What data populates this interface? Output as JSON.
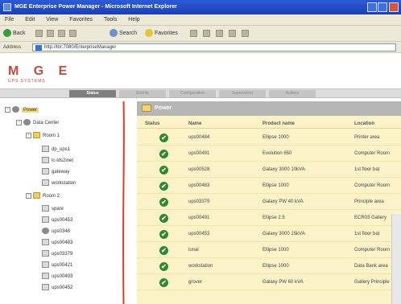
{
  "window": {
    "title": "MGE Enterprise Power Manager - Microsoft Internet Explorer"
  },
  "menu": [
    "File",
    "Edit",
    "View",
    "Favorites",
    "Tools",
    "Help"
  ],
  "toolbar": {
    "back_label": "Back",
    "search_label": "Search",
    "favorites_label": "Favorites"
  },
  "address": {
    "label": "Address",
    "value": "http://lbr:7080/EnterpriseManager"
  },
  "brand": {
    "logo": "M G E",
    "tagline": "UPS SYSTEMS"
  },
  "tabs": [
    "Status",
    "Events",
    "Configuration",
    "Supervision",
    "Actions"
  ],
  "tree": {
    "root": "Power",
    "datacenter": "Data Center",
    "rooms": [
      "Room 1",
      "Room 2"
    ],
    "room1_items": [
      "dp_ups1",
      "lc-lds2inet",
      "gateway",
      "workstation"
    ],
    "room2_items": [
      "spare",
      "ups00453",
      "ups0348",
      "ups00483",
      "ups03379",
      "ups00421",
      "ups00493",
      "ups00452"
    ]
  },
  "grid": {
    "title": "Power",
    "headers": [
      "Status",
      "Name",
      "Product name",
      "Location"
    ],
    "rows": [
      {
        "name": "ups00484",
        "product": "Ellipse 1000",
        "location": "Printer area"
      },
      {
        "name": "ups00491",
        "product": "Evolution 650",
        "location": "Computer Room"
      },
      {
        "name": "ups00528",
        "product": "Galaxy 3000 10kVA",
        "location": "1st floor bat"
      },
      {
        "name": "ups00483",
        "product": "Ellipse 1000",
        "location": "Computer Room"
      },
      {
        "name": "ups03379",
        "product": "Galaxy PW 40 kVA",
        "location": "Principle area"
      },
      {
        "name": "ups00491",
        "product": "Ellipse 2.5",
        "location": "ECR03 Gallery"
      },
      {
        "name": "ups00453",
        "product": "Galaxy 3000 15kVA",
        "location": "1st floor bat"
      },
      {
        "name": "lunal",
        "product": "Ellipse 1000",
        "location": "Computer Room"
      },
      {
        "name": "workstation",
        "product": "Ellipse 1000",
        "location": "Data Bank area"
      },
      {
        "name": "grover",
        "product": "Galaxy PW 60 kVA",
        "location": "Gallery Principle"
      }
    ]
  },
  "colors": {
    "accent": "#c14b3a",
    "ok": "#2f8a2f",
    "grid_bg": "#fbf3c7",
    "annotation": "#e03a2a"
  }
}
